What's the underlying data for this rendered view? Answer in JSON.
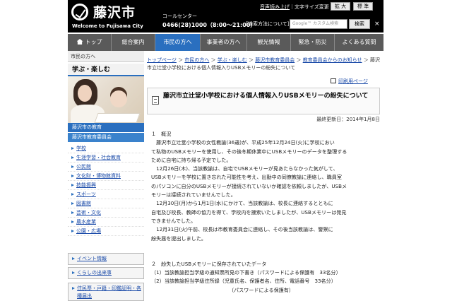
{
  "header": {
    "city_name": "藤沢市",
    "city_sub": "Welcome to Fujisawa City",
    "callcenter_label": "コールセンター",
    "callcenter_phone": "0466(28)1000（8:00～21:00）",
    "util_read": "音声読み上げ",
    "util_sep": "｜文字サイズ変更",
    "font_large": "拡 大",
    "font_standard": "標 準",
    "search_how": "［検索方法について］",
    "search_placeholder": "Google™ カスタム検索",
    "search_button": "検索",
    "close_label": "×"
  },
  "nav": {
    "items": [
      {
        "label": "トップ"
      },
      {
        "label": "総合案内"
      },
      {
        "label": "市民の方へ"
      },
      {
        "label": "事業者の方へ"
      },
      {
        "label": "観光情報"
      },
      {
        "label": "緊急・防災"
      },
      {
        "label": "よくある質問"
      }
    ]
  },
  "left": {
    "breadcrumb": "市民の方へ",
    "heading": "学ぶ・楽しむ",
    "section1": "藤沢市の教育",
    "section2": "藤沢市教育委員会",
    "items": [
      "学校",
      "生涯学習・社会教育",
      "公民館",
      "文化財・博物館資料",
      "技能振興",
      "スポーツ",
      "図書館",
      "芸術・文化",
      "農水産業",
      "公園・広場"
    ],
    "box1": "イベント情報",
    "box2": "くらしの出来事",
    "box3_line1": "住民票・戸籍・印鑑証明・各",
    "box3_line2": "種届出"
  },
  "main": {
    "bc_top": "トップページ",
    "bc_sep": " ＞ ",
    "bc_citizens": "市民の方へ",
    "bc_learn": "学ぶ・楽しむ",
    "bc_board": "藤沢市教育委員会",
    "bc_notice": "教育委員会からのお知らせ",
    "bc_current": "藤沢市立辻堂小学校における個人情報入りUSBメモリーの紛失について",
    "print": "印刷用ページ",
    "title": "藤沢市立辻堂小学校における個人情報入りUSBメモリーの紛失について",
    "updated": "最終更新日：2014年1月8日",
    "body": [
      "１　概況",
      "　藤沢市立辻堂小学校の女性教諭(36歳)が、平成25年12月24日(火)に学校におい",
      "て私物のUSBメモリーを使用し、その後冬期休業中にUSBメモリーのデータを整理する",
      "ために自宅に持ち帰る予定でした。",
      "　12月26日(木)、当該教諭は、自宅でUSBメモリーが見あたらなかった気がして、",
      "USBメモリーを学校に置き忘れた可能性を考え、出勤中の同僚教諭に連絡し、職員室",
      "のパソコンに自分のUSBメモリーが接続されていないか確認を依頼しましたが、USBメ",
      "モリーは接続されていませんでした。",
      "　12月30日(月)から1月1日(水)にかけて、当該教諭は、校長に連絡するとともに",
      "自宅及び校長、教師の協力を得て、学校内を捜索いたしましたが、USBメモリーは発見",
      "できませんでした。",
      "　12月31日(火)午前、校長は市教育委員会に連絡し、その後当該教諭は、警察に",
      "紛失届を提出しました。",
      "",
      "２　紛失したUSBメモリーに保存されていたデータ",
      "（1）当該教諭担当学級の通知票所見の下書き（パスワードによる保護有　33名分）",
      "（2）当該教諭担当学級住所録（児童氏名、保護者名、住所、電話番号　33名分）",
      "　　　　　　　　　　　　　　　　（パスワードによる保護有）"
    ]
  }
}
